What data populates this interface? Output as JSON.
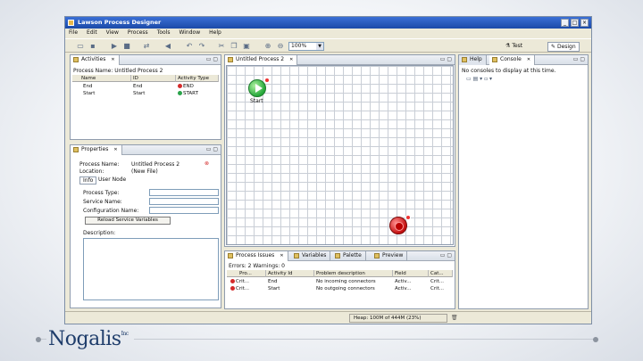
{
  "window": {
    "title": "Lawson Process Designer",
    "controls": [
      "_",
      "□",
      "×"
    ]
  },
  "menu": [
    "File",
    "Edit",
    "View",
    "Process",
    "Tools",
    "Window",
    "Help"
  ],
  "toolbar": {
    "zoom": "100%",
    "perspectives": [
      "Test",
      "Design"
    ]
  },
  "activities": {
    "tab": "Activities",
    "process_label": "Process Name: Untitled Process 2",
    "columns": [
      "Name",
      "ID",
      "Activity Type"
    ],
    "rows": [
      {
        "name": "End",
        "id": "End",
        "type": "END"
      },
      {
        "name": "Start",
        "id": "Start",
        "type": "START"
      }
    ]
  },
  "properties": {
    "tab": "Properties",
    "process_name_label": "Process Name:",
    "process_name_value": "Untitled Process 2",
    "location_label": "Location:",
    "location_value": "(New File)",
    "subtabs": [
      "Info",
      "User Node"
    ],
    "fields": [
      "Process Type:",
      "Service Name:",
      "Configuration Name:"
    ],
    "reload_button": "Reload Service Variables",
    "description_label": "Description:"
  },
  "designer": {
    "tab": "Untitled Process 2",
    "start_label": "Start"
  },
  "help_panel": {
    "tabs": [
      "Help",
      "Console"
    ],
    "message": "No consoles to display at this time."
  },
  "issues": {
    "tabs": [
      "Process Issues",
      "Variables",
      "Palette",
      "Preview"
    ],
    "summary": "Errors: 2    Warnings: 0",
    "columns": [
      "Pro...",
      "Activity Id",
      "Problem description",
      "Field",
      "Cat..."
    ],
    "rows": [
      {
        "type": "Crit...",
        "activity": "End",
        "problem": "No incoming connectors",
        "field": "Activ...",
        "cat": "Crit..."
      },
      {
        "type": "Crit...",
        "activity": "Start",
        "problem": "No outgoing connectors",
        "field": "Activ...",
        "cat": "Crit..."
      }
    ]
  },
  "status": {
    "memory": "Heap: 100M of 444M (23%)"
  },
  "brand": {
    "name": "Nogalis",
    "tm": "Inc"
  }
}
